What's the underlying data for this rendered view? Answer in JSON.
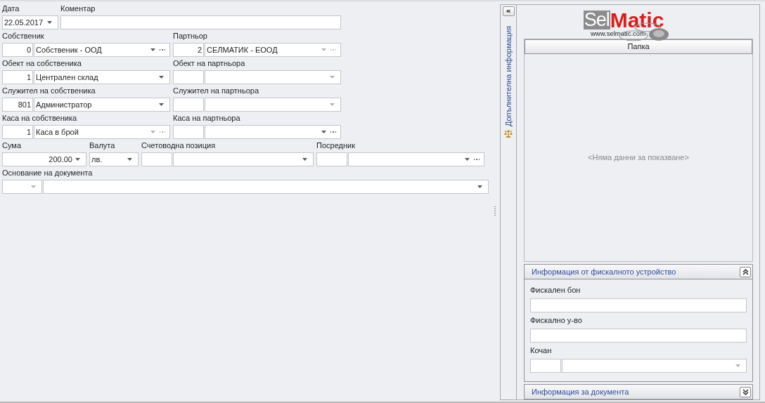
{
  "form": {
    "rows": [
      {
        "fields": [
          {
            "label": "Дата",
            "kind": "date",
            "value": "22.05.2017"
          },
          {
            "label": "Коментар",
            "kind": "text"
          }
        ]
      },
      {
        "fields": [
          {
            "label": "Собственик",
            "kind": "lookup",
            "code": "0",
            "value": "Собственик - ООД",
            "ellipsis": true,
            "disabled": false
          },
          {
            "label": "Партньор",
            "kind": "lookup",
            "code": "2",
            "value": "СЕЛМАТИК - ЕООД",
            "ellipsis": true,
            "disabled": true
          }
        ]
      },
      {
        "fields": [
          {
            "label": "Обект на собственика",
            "kind": "lookup",
            "code": "1",
            "value": "Централен склад",
            "ellipsis": false,
            "disabled": false
          },
          {
            "label": "Обект на партньора",
            "kind": "lookup",
            "ellipsis": false,
            "disabled": true
          }
        ]
      },
      {
        "fields": [
          {
            "label": "Служител на собственика",
            "kind": "lookup",
            "code": "801",
            "value": "Администратор",
            "ellipsis": false,
            "disabled": false
          },
          {
            "label": "Служител на партньора",
            "kind": "lookup",
            "ellipsis": false,
            "disabled": true
          }
        ]
      },
      {
        "fields": [
          {
            "label": "Каса на собственика",
            "kind": "lookup",
            "code": "1",
            "value": "Каса в брой",
            "ellipsis": true,
            "disabled": true
          },
          {
            "label": "Каса на партньора",
            "kind": "lookup",
            "ellipsis": true,
            "disabled": false
          }
        ]
      },
      {
        "fields": [
          {
            "label": "Сума",
            "kind": "amount",
            "value": "200.00"
          },
          {
            "label": "Валута",
            "kind": "combo",
            "value": "лв."
          },
          {
            "label": "Счетоводна позиция",
            "kind": "lookup",
            "ellipsis": false,
            "disabled": false
          },
          {
            "label": "Посредник",
            "kind": "lookup",
            "ellipsis": true,
            "disabled": false
          }
        ]
      },
      {
        "fields": [
          {
            "label": "Основание на документа",
            "kind": "split_combo",
            "first_disabled": true
          }
        ]
      }
    ]
  },
  "side_tab": {
    "label": "Допълнителна информация",
    "collapse": "«"
  },
  "logo": {
    "part_1": "Sel",
    "part_2": "Matic",
    "url": "www.selmatic.com"
  },
  "grid": {
    "columns": [
      "Папка"
    ],
    "empty_text": "<Няма данни за показване>"
  },
  "groups": [
    {
      "title": "Информация от фискалното устройство",
      "expanded": true,
      "fields": [
        {
          "label": "Фискален бон",
          "kind": "text"
        },
        {
          "label": "Фискално у-во",
          "kind": "text"
        },
        {
          "label": "Кочан",
          "kind": "lookup",
          "ellipsis": false,
          "disabled": true
        }
      ]
    },
    {
      "title": "Информация за документа",
      "expanded": false
    }
  ]
}
